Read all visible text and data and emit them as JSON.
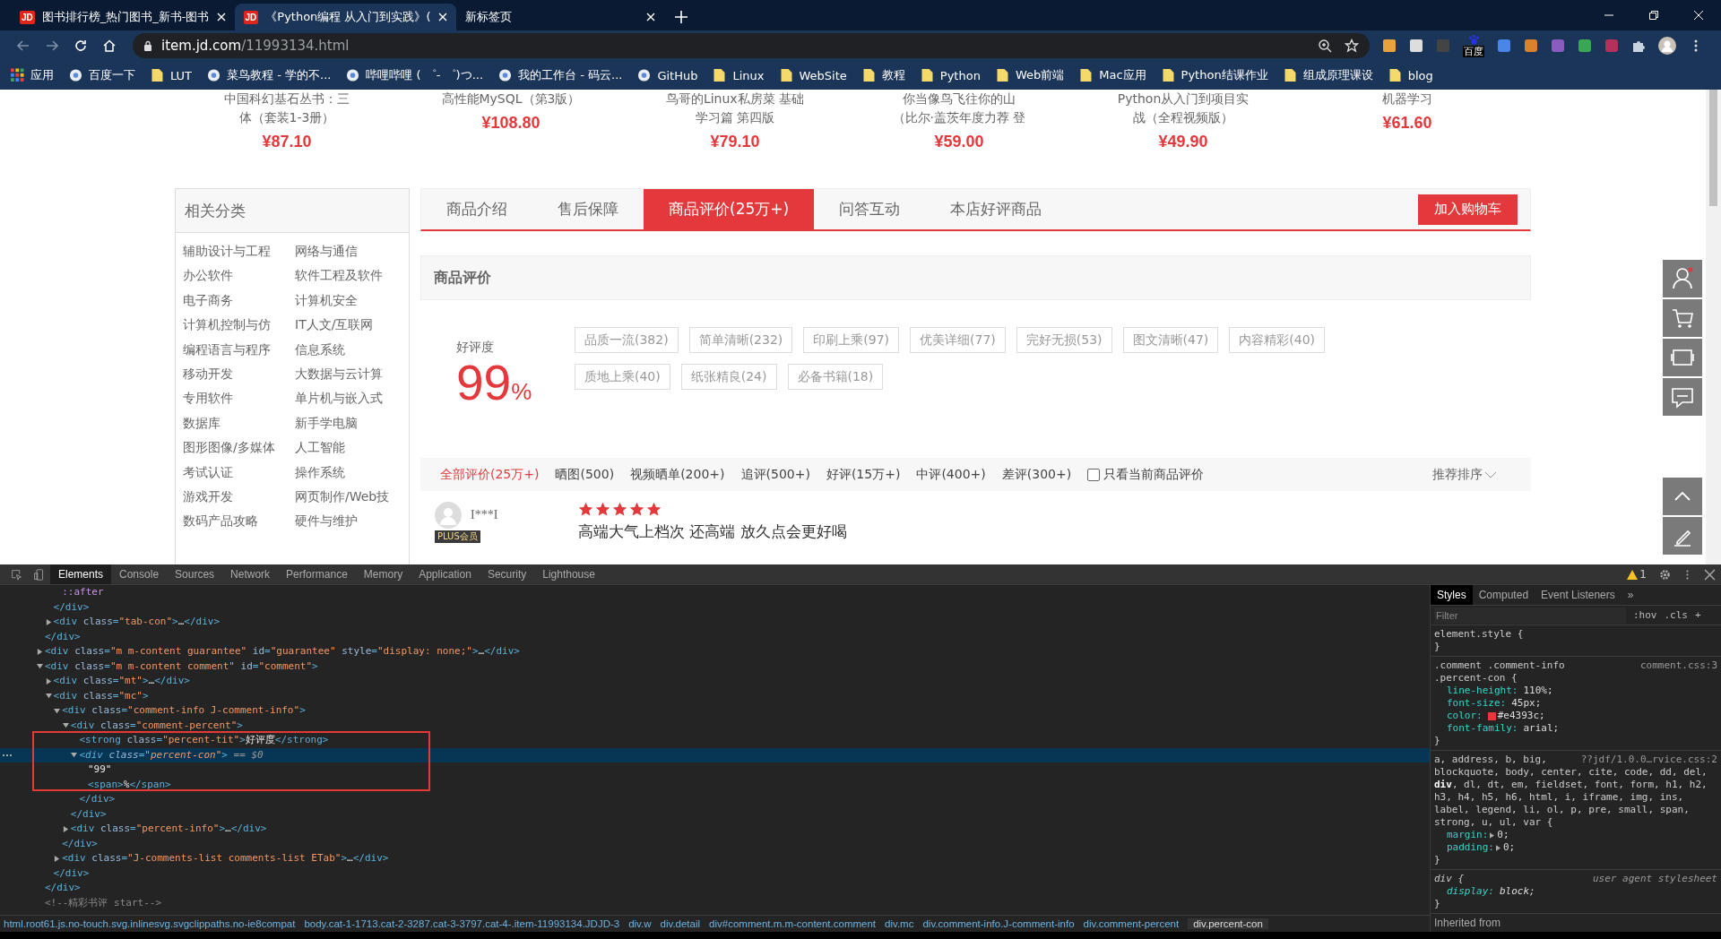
{
  "browser": {
    "tabs": [
      {
        "favicon": "JD",
        "title": "图书排行榜_热门图书_新书-图书",
        "selected": false
      },
      {
        "favicon": "JD",
        "title": "《Python编程 从入门到实践》(",
        "selected": true
      },
      {
        "title": "新标签页",
        "selected": false
      }
    ],
    "address": {
      "host": "item.jd.com",
      "path": "/11993134.html"
    },
    "extension_badge": "百度",
    "bookmarks": [
      {
        "kind": "apps",
        "label": "应用"
      },
      {
        "kind": "site",
        "label": "百度一下"
      },
      {
        "kind": "folder",
        "label": "LUT"
      },
      {
        "kind": "site",
        "label": "菜鸟教程 - 学的不..."
      },
      {
        "kind": "site",
        "label": "哔哩哔哩 ( ゜- ゜)つ..."
      },
      {
        "kind": "site",
        "label": "我的工作台 - 码云..."
      },
      {
        "kind": "site",
        "label": "GitHub"
      },
      {
        "kind": "folder",
        "label": "Linux"
      },
      {
        "kind": "folder",
        "label": "WebSite"
      },
      {
        "kind": "folder",
        "label": "教程"
      },
      {
        "kind": "folder",
        "label": "Python"
      },
      {
        "kind": "folder",
        "label": "Web前端"
      },
      {
        "kind": "folder",
        "label": "Mac应用"
      },
      {
        "kind": "folder",
        "label": "Python结课作业"
      },
      {
        "kind": "folder",
        "label": "组成原理课设"
      },
      {
        "kind": "folder",
        "label": "blog"
      }
    ]
  },
  "page": {
    "products": [
      {
        "title_lines": [
          "中国科幻基石丛书：三",
          "体（套装1-3册）"
        ],
        "price": "¥87.10"
      },
      {
        "title_lines": [
          "高性能MySQL（第3版）"
        ],
        "price": "¥108.80"
      },
      {
        "title_lines": [
          "鸟哥的Linux私房菜 基础",
          "学习篇 第四版"
        ],
        "price": "¥79.10"
      },
      {
        "title_lines": [
          "你当像鸟飞往你的山",
          "（比尔·盖茨年度力荐 登"
        ],
        "price": "¥59.00"
      },
      {
        "title_lines": [
          "Python从入门到项目实",
          "战（全程视频版）"
        ],
        "price": "¥49.90"
      },
      {
        "title_lines": [
          "机器学习"
        ],
        "price": "¥61.60"
      }
    ],
    "sidebar": {
      "title": "相关分类",
      "items": [
        "辅助设计与工程",
        "网络与通信",
        "办公软件",
        "软件工程及软件",
        "电子商务",
        "计算机安全",
        "计算机控制与仿",
        "IT人文/互联网",
        "编程语言与程序",
        "信息系统",
        "移动开发",
        "大数据与云计算",
        "专用软件",
        "单片机与嵌入式",
        "数据库",
        "新手学电脑",
        "图形图像/多媒体",
        "人工智能",
        "考试认证",
        "操作系统",
        "游戏开发",
        "网页制作/Web技",
        "数码产品攻略",
        "硬件与维护"
      ]
    },
    "tabs": [
      {
        "label": "商品介绍",
        "selected": false
      },
      {
        "label": "售后保障",
        "selected": false
      },
      {
        "label": "商品评价(25万+)",
        "selected": true
      },
      {
        "label": "问答互动",
        "selected": false
      },
      {
        "label": "本店好评商品",
        "selected": false
      }
    ],
    "cart_button": "加入购物车",
    "section_title": "商品评价",
    "rating": {
      "label": "好评度",
      "value": "99",
      "unit": "%"
    },
    "tags": [
      "品质一流(382)",
      "简单清晰(232)",
      "印刷上乘(97)",
      "优美详细(77)",
      "完好无损(53)",
      "图文清晰(47)",
      "内容精彩(40)",
      "质地上乘(40)",
      "纸张精良(24)",
      "必备书籍(18)"
    ],
    "filters": [
      {
        "label": "全部评价(25万+)",
        "selected": true
      },
      {
        "label": "晒图(500)",
        "selected": false
      },
      {
        "label": "视频晒单(200+)",
        "selected": false
      },
      {
        "label": "追评(500+)",
        "selected": false
      },
      {
        "label": "好评(15万+)",
        "selected": false
      },
      {
        "label": "中评(400+)",
        "selected": false
      },
      {
        "label": "差评(300+)",
        "selected": false
      }
    ],
    "only_current": {
      "label": "只看当前商品评价",
      "checked": false
    },
    "sort": "推荐排序",
    "review": {
      "user": "I***I",
      "badge": "PLUS会员",
      "stars": 5,
      "text": "高端大气上档次 还高端 放久点会更好喝"
    }
  },
  "devtools": {
    "tabs": [
      {
        "label": "Elements",
        "selected": true
      },
      {
        "label": "Console",
        "selected": false
      },
      {
        "label": "Sources",
        "selected": false
      },
      {
        "label": "Network",
        "selected": false
      },
      {
        "label": "Performance",
        "selected": false
      },
      {
        "label": "Memory",
        "selected": false
      },
      {
        "label": "Application",
        "selected": false
      },
      {
        "label": "Security",
        "selected": false
      },
      {
        "label": "Lighthouse",
        "selected": false
      }
    ],
    "warnings": "1",
    "dom": [
      {
        "children": [
          {
            "children": [
              {
                "text": "::after"
              }
            ]
          },
          {
            "text": "</div>"
          },
          {
            "text": "<div class=\"tab-con\">…</div>",
            "expanded": false
          }
        ]
      },
      {
        "text": "</div>"
      },
      {
        "text": "<div class=\"m m-content guarantee\" id=\"guarantee\" style=\"display: none;\">…</div>",
        "expanded": false
      },
      {
        "text": "<div class=\"m m-content comment\" id=\"comment\">",
        "expanded": true,
        "children": [
          {
            "text": "<div class=\"mt\">…</div>",
            "expanded": false
          },
          {
            "text": "<div class=\"mc\">",
            "expanded": true,
            "children": [
              {
                "text": "<div class=\"comment-info J-comment-info\">",
                "expanded": true,
                "children": [
                  {
                    "text": "<div class=\"comment-percent\">",
                    "expanded": true,
                    "children": [
                      {
                        "text": "<strong class=\"percent-tit\">好评度</strong>"
                      },
                      {
                        "text": "<div class=\"percent-con\"> == $0",
                        "expanded": true,
                        "selected": true,
                        "children": [
                          {
                            "text": "\"99\""
                          },
                          {
                            "text": "<span>%</span>"
                          }
                        ]
                      },
                      {
                        "text": "</div>"
                      }
                    ]
                  },
                  {
                    "text": "</div>"
                  },
                  {
                    "text": "<div class=\"percent-info\">…</div>",
                    "expanded": false
                  }
                ]
              },
              {
                "text": "</div>"
              },
              {
                "text": "<div class=\"J-comments-list comments-list ETab\">…</div>",
                "expanded": false
              }
            ]
          },
          {
            "text": "</div>"
          }
        ]
      },
      {
        "text": "</div>"
      },
      {
        "text": "<!--精彩书评 start-->"
      }
    ],
    "breadcrumbs": [
      {
        "label": "html.root61.js.no-touch.svg.inlinesvg.svgclippaths.no-ie8compat",
        "selected": false
      },
      {
        "label": "body.cat-1-1713.cat-2-3287.cat-3-3797.cat-4-.item-11993134.JDJD-3",
        "selected": false
      },
      {
        "label": "div.w",
        "selected": false
      },
      {
        "label": "div.detail",
        "selected": false
      },
      {
        "label": "div#comment.m.m-content.comment",
        "selected": false
      },
      {
        "label": "div.mc",
        "selected": false
      },
      {
        "label": "div.comment-info.J-comment-info",
        "selected": false
      },
      {
        "label": "div.comment-percent",
        "selected": false
      },
      {
        "label": "div.percent-con",
        "selected": true
      }
    ],
    "styles": {
      "tabs": [
        {
          "label": "Styles",
          "selected": true
        },
        {
          "label": "Computed",
          "selected": false
        },
        {
          "label": "Event Listeners",
          "selected": false
        }
      ],
      "more": "»",
      "filter_placeholder": "Filter",
      "hov": ":hov",
      "cls": ".cls",
      "add": "+",
      "rules": [
        {
          "selector_lines": [
            "element.style {"
          ],
          "end": "}"
        },
        {
          "selector_lines": [
            ".comment .comment-info",
            ".percent-con {"
          ],
          "source": "comment.css:3",
          "declarations": [
            {
              "name": "line-height:",
              "value": "110%;"
            },
            {
              "name": "font-size:",
              "value": "45px;"
            },
            {
              "name": "color:",
              "value": "#e4393c;",
              "kind": "color"
            },
            {
              "name": "font-family:",
              "value": "arial;"
            }
          ],
          "end": "}"
        },
        {
          "selector_lines": [
            "a, address, b, big,",
            "blockquote, body, center, cite, code, dd, del,",
            "**div**, dl, dt, em, fieldset, font, form, h1, h2,",
            "h3, h4, h5, h6, html, i, iframe, img, ins,",
            "label, legend, li, ol, p, pre, small, span,",
            "strong, u, ul, var {"
          ],
          "source": "??jdf/1.0.0…rvice.css:2",
          "declarations": [
            {
              "name": "margin:",
              "value": "0;",
              "kind": "shorthand"
            },
            {
              "name": "padding:",
              "value": "0;",
              "kind": "shorthand"
            }
          ],
          "end": "}"
        },
        {
          "selector_lines": [
            "div {"
          ],
          "source": "user agent stylesheet",
          "user_agent": true,
          "declarations": [
            {
              "name": "display:",
              "value": "block;"
            }
          ],
          "end": "}"
        }
      ],
      "inherited": "Inherited from"
    }
  }
}
